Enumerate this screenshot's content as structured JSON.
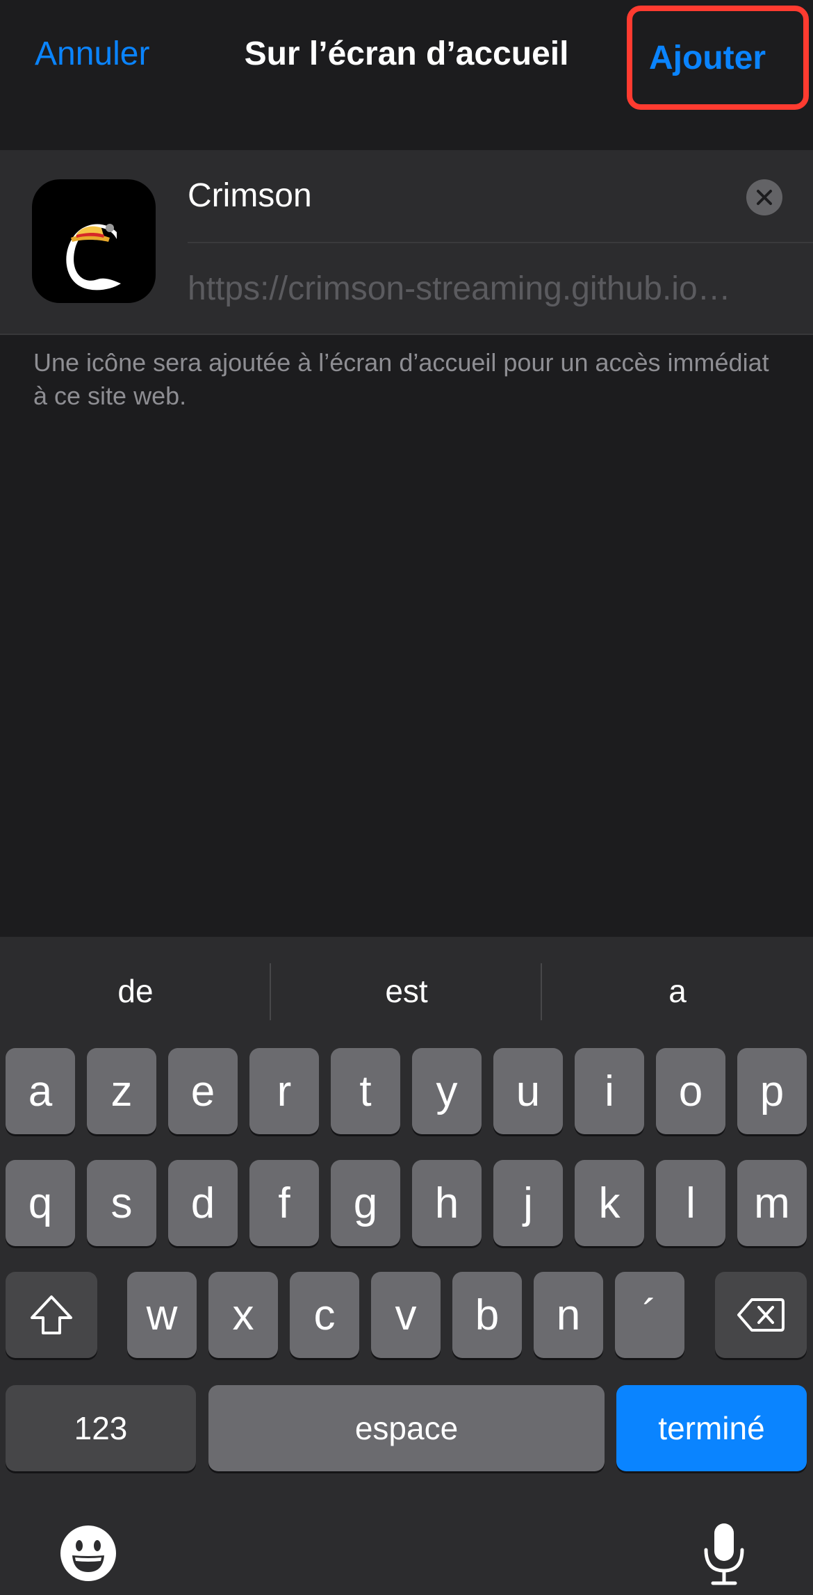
{
  "nav": {
    "cancel": "Annuler",
    "title": "Sur l’écran d’accueil",
    "add": "Ajouter"
  },
  "form": {
    "name_value": "Crimson",
    "url_value": "https://crimson-streaming.github.io…"
  },
  "note": "Une icône sera ajoutée à l’écran d’accueil pour un accès immédiat à ce site web.",
  "keyboard": {
    "suggestions": [
      "de",
      "est",
      "a"
    ],
    "row1": [
      "a",
      "z",
      "e",
      "r",
      "t",
      "y",
      "u",
      "i",
      "o",
      "p"
    ],
    "row2": [
      "q",
      "s",
      "d",
      "f",
      "g",
      "h",
      "j",
      "k",
      "l",
      "m"
    ],
    "row3": [
      "w",
      "x",
      "c",
      "v",
      "b",
      "n",
      "´"
    ],
    "numbers": "123",
    "space": "espace",
    "done": "terminé",
    "shift_icon": "shift-icon",
    "backspace_icon": "backspace-icon",
    "emoji_icon": "emoji-icon",
    "mic_icon": "microphone-icon"
  },
  "colors": {
    "accent": "#0a84ff",
    "highlight": "#ff3b30",
    "background": "#1c1c1e"
  }
}
